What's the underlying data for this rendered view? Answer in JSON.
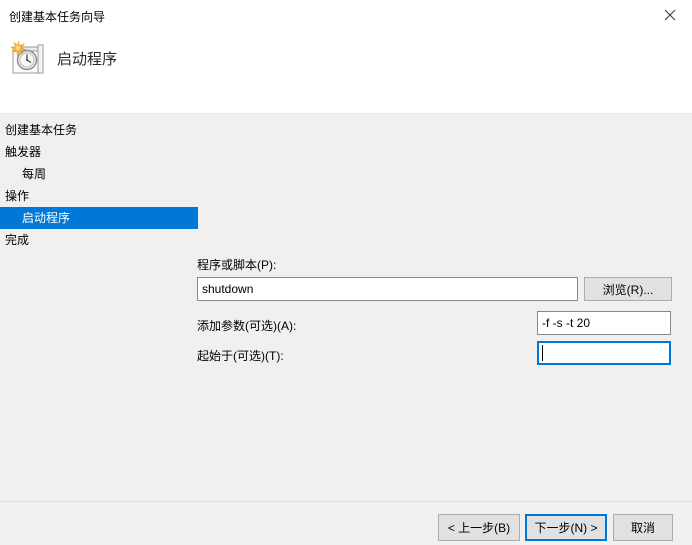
{
  "window": {
    "title": "创建基本任务向导",
    "close_icon": "close-icon"
  },
  "header": {
    "icon": "task-scheduler-new-task-icon",
    "title": "启动程序"
  },
  "sidebar": {
    "items": [
      {
        "label": "创建基本任务",
        "indent": false,
        "selected": false
      },
      {
        "label": "触发器",
        "indent": false,
        "selected": false
      },
      {
        "label": "每周",
        "indent": true,
        "selected": false
      },
      {
        "label": "操作",
        "indent": false,
        "selected": false
      },
      {
        "label": "启动程序",
        "indent": true,
        "selected": true
      },
      {
        "label": "完成",
        "indent": false,
        "selected": false
      }
    ],
    "selected_color": "#0078d7"
  },
  "form": {
    "program_label": "程序或脚本(P):",
    "program_value": "shutdown",
    "program_placeholder": "",
    "browse_label": "浏览(R)...",
    "arguments_label": "添加参数(可选)(A):",
    "arguments_value": "-f -s -t 20",
    "arguments_placeholder": "",
    "start_in_label": "起始于(可选)(T):",
    "start_in_value": "",
    "start_in_placeholder": "",
    "focused_field": "start_in"
  },
  "footer": {
    "back_label": "< 上一步(B)",
    "next_label": "下一步(N) >",
    "cancel_label": "取消",
    "default_button": "next",
    "focus_color": "#0078d7"
  }
}
